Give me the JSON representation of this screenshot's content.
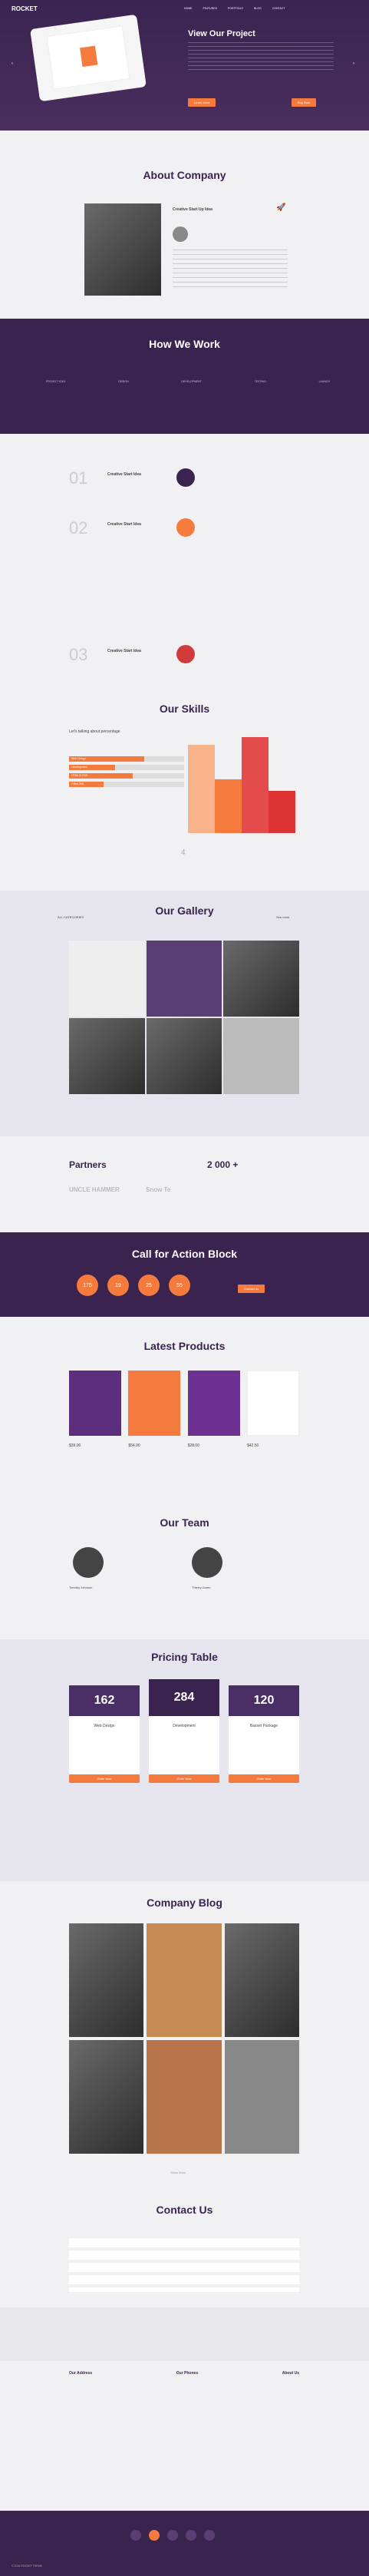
{
  "header": {
    "logo": "ROCKET",
    "nav": [
      "HOME",
      "FEATURES",
      "PORTFOLIO",
      "BLOG",
      "CONTACT"
    ]
  },
  "hero": {
    "title": "View Our Project",
    "btn1": "Learn more",
    "btn2": "Buy Now"
  },
  "about": {
    "title": "About Company",
    "name": "Creative Start Up Idea"
  },
  "how": {
    "title": "How We Work",
    "tabs": [
      "PROJECT IDEA",
      "DESIGN",
      "DEVELOPMENT",
      "TESTING",
      "LAUNCH"
    ],
    "steps": [
      {
        "num": "01",
        "title": "Creative Start Idea"
      },
      {
        "num": "02",
        "title": "Creative Start Idea"
      },
      {
        "num": "03",
        "title": "Creative Start Idea"
      }
    ]
  },
  "skills": {
    "title": "Our Skills",
    "heading": "Let's talking about percentage",
    "bars": [
      {
        "label": "Web Design",
        "pct": 0.65
      },
      {
        "label": "Development",
        "pct": 0.4
      },
      {
        "label": "HTML & CSS",
        "pct": 0.55
      },
      {
        "label": "Office 365",
        "pct": 0.3
      }
    ],
    "scroll": "4"
  },
  "gallery": {
    "title": "Our Gallery",
    "filter": "ALL CATEGORIES",
    "more": "See more"
  },
  "partners": {
    "title": "Partners",
    "count": "2 000 +",
    "logos": [
      "UNCLE HAMMER",
      "Snow Te"
    ]
  },
  "cta": {
    "title": "Call for Action Block",
    "stats": [
      "175",
      "19",
      "25",
      "55"
    ],
    "btn": "Contact us"
  },
  "products": {
    "title": "Latest Products",
    "items": [
      {
        "price": "$39.00"
      },
      {
        "price": "$54.90"
      },
      {
        "price": "$28.00"
      },
      {
        "price": "$42.50"
      }
    ]
  },
  "team": {
    "title": "Our Team",
    "members": [
      {
        "name": "Timothy Johnson"
      },
      {
        "name": "Thierry Jonen"
      }
    ]
  },
  "pricing": {
    "title": "Pricing Table",
    "plans": [
      {
        "price": "162",
        "name": "Web Design"
      },
      {
        "price": "284",
        "name": "Development"
      },
      {
        "price": "120",
        "name": "Basset Package"
      }
    ],
    "btn": "Order Now"
  },
  "blog": {
    "title": "Company Blog",
    "more": "Show More"
  },
  "contact": {
    "title": "Contact Us",
    "info": [
      {
        "label": "Our Address"
      },
      {
        "label": "Our Phones"
      },
      {
        "label": "About Us"
      }
    ]
  },
  "footer": {
    "copy": "© 2016 ROCKET THEME"
  },
  "colors": {
    "accent": "#f47b3d",
    "purple": "#3b2350"
  }
}
